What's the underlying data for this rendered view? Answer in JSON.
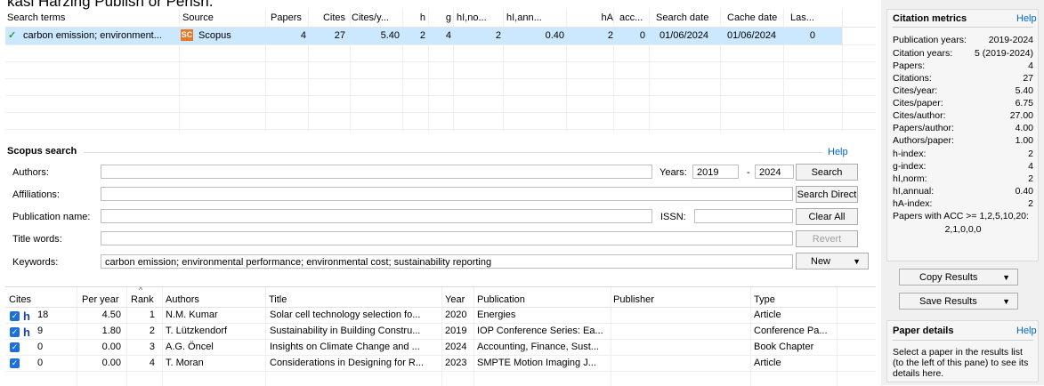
{
  "window_caption": "kasi Harzing Publish or Perish.",
  "results": {
    "columns": [
      "Search terms",
      "Source",
      "Papers",
      "Cites",
      "Cites/y...",
      "h",
      "g",
      "hI,no...",
      "hI,ann...",
      "hA",
      "acc...",
      "Search date",
      "Cache date",
      "Las..."
    ],
    "row": {
      "search_terms": "carbon emission; environment...",
      "source_badge": "SC",
      "source": "Scopus",
      "papers": "4",
      "cites": "27",
      "cites_per_year": "5.40",
      "h": "2",
      "g": "4",
      "hi_norm": "2",
      "hi_annual": "0.40",
      "ha": "2",
      "acc": "0",
      "search_date": "01/06/2024",
      "cache_date": "01/06/2024",
      "last": "0"
    }
  },
  "scopus": {
    "title": "Scopus search",
    "help": "Help",
    "authors_label": "Authors:",
    "affiliations_label": "Affiliations:",
    "publication_label": "Publication name:",
    "title_words_label": "Title words:",
    "keywords_label": "Keywords:",
    "keywords_value": "carbon emission; environmental performance;  environmental cost; sustainability reporting",
    "years_label": "Years:",
    "year_from": "2019",
    "year_sep": "-",
    "year_to": "2024",
    "issn_label": "ISSN:",
    "buttons": {
      "search": "Search",
      "search_direct": "Search Direct",
      "clear_all": "Clear All",
      "revert": "Revert",
      "new": "New"
    }
  },
  "papers": {
    "columns": [
      "Cites",
      "Per year",
      "Rank",
      "Authors",
      "Title",
      "Year",
      "Publication",
      "Publisher",
      "Type"
    ],
    "rows": [
      {
        "h": "h",
        "cites": "18",
        "per_year": "4.50",
        "rank": "1",
        "authors": "N.M. Kumar",
        "title": "Solar cell technology selection fo...",
        "year": "2020",
        "publication": "Energies",
        "publisher": "",
        "type": "Article"
      },
      {
        "h": "h",
        "cites": "9",
        "per_year": "1.80",
        "rank": "2",
        "authors": "T. Lützkendorf",
        "title": "Sustainability in Building Constru...",
        "year": "2019",
        "publication": "IOP Conference Series: Ea...",
        "publisher": "",
        "type": "Conference Pa..."
      },
      {
        "h": "",
        "cites": "0",
        "per_year": "0.00",
        "rank": "3",
        "authors": "A.G. Öncel",
        "title": "Insights on Climate Change and ...",
        "year": "2024",
        "publication": "Accounting, Finance, Sust...",
        "publisher": "",
        "type": "Book Chapter"
      },
      {
        "h": "",
        "cites": "0",
        "per_year": "0.00",
        "rank": "4",
        "authors": "T. Moran",
        "title": "Considerations in Designing for R...",
        "year": "2023",
        "publication": "SMPTE Motion Imaging J...",
        "publisher": "",
        "type": "Article"
      }
    ]
  },
  "metrics": {
    "title": "Citation metrics",
    "help": "Help",
    "rows": [
      {
        "label": "Publication years:",
        "value": "2019-2024"
      },
      {
        "label": "Citation years:",
        "value": "5 (2019-2024)"
      },
      {
        "label": "Papers:",
        "value": "4"
      },
      {
        "label": "Citations:",
        "value": "27"
      },
      {
        "label": "Cites/year:",
        "value": "5.40"
      },
      {
        "label": "Cites/paper:",
        "value": "6.75"
      },
      {
        "label": "Cites/author:",
        "value": "27.00"
      },
      {
        "label": "Papers/author:",
        "value": "4.00"
      },
      {
        "label": "Authors/paper:",
        "value": "1.00"
      },
      {
        "label": "h-index:",
        "value": "2"
      },
      {
        "label": "g-index:",
        "value": "4"
      },
      {
        "label": "hI,norm:",
        "value": "2"
      },
      {
        "label": "hI,annual:",
        "value": "0.40"
      },
      {
        "label": "hA-index:",
        "value": "2"
      }
    ],
    "acc_label": "Papers with ACC >= 1,2,5,10,20:",
    "acc_value": "2,1,0,0,0",
    "copy_results": "Copy Results",
    "save_results": "Save Results"
  },
  "paper_details": {
    "title": "Paper details",
    "help": "Help",
    "text": "Select a paper in the results list (to the left of this pane) to see its details here."
  },
  "colors": {
    "selection": "#cce8ff",
    "accent_blue": "#1e6fd9",
    "scopus_orange": "#e87722",
    "check_green": "#2e9a3a"
  }
}
